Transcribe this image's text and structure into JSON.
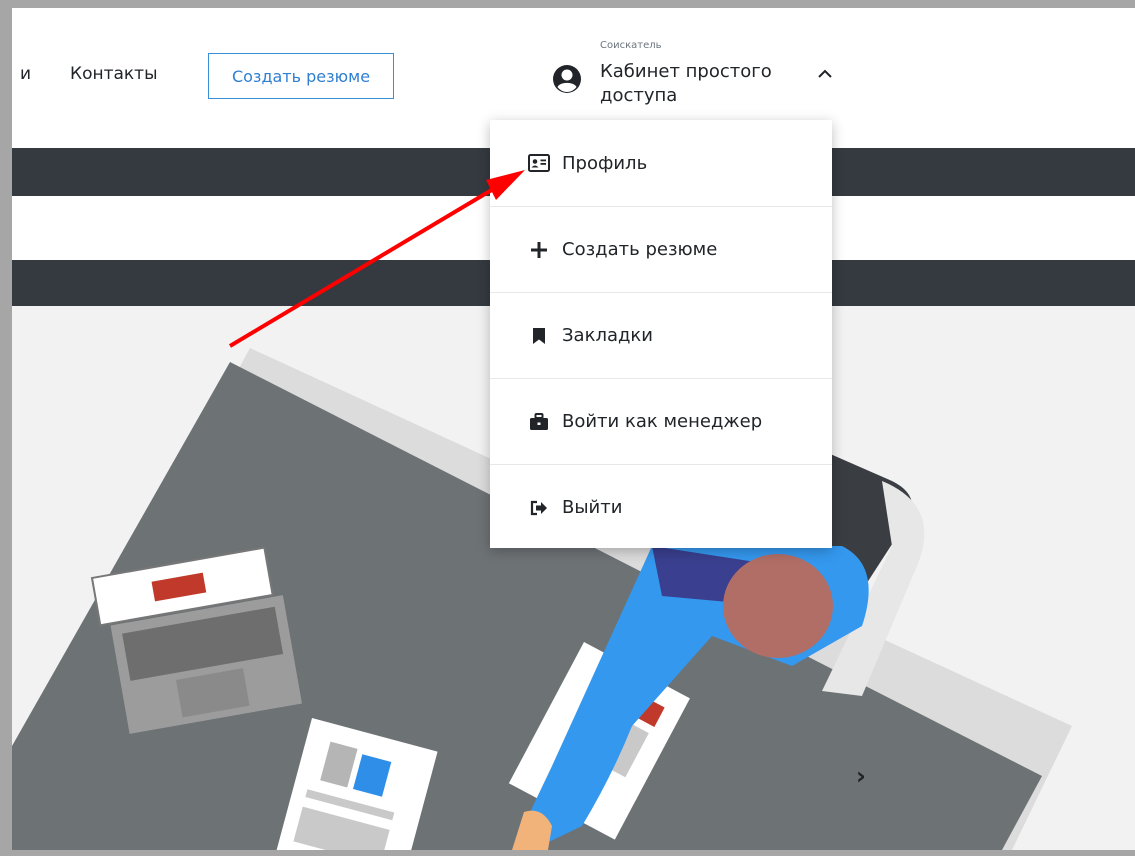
{
  "nav": {
    "truncated_item": "и",
    "contacts": "Контакты",
    "create_resume_button": "Создать резюме"
  },
  "cabinet": {
    "role": "Соискатель",
    "name": "Кабинет простого доступа",
    "icon": "user-circle-icon",
    "expanded_icon": "chevron-up-icon"
  },
  "dropdown": {
    "items": [
      {
        "label": "Профиль",
        "icon": "id-card-icon"
      },
      {
        "label": "Создать резюме",
        "icon": "plus-icon"
      },
      {
        "label": "Закладки",
        "icon": "bookmark-icon"
      },
      {
        "label": "Войти как менеджер",
        "icon": "briefcase-icon"
      },
      {
        "label": "Выйти",
        "icon": "sign-out-icon"
      }
    ]
  },
  "carousel": {
    "next": "›"
  },
  "colors": {
    "accent": "#2f7fd1",
    "dark_band": "#343a40",
    "annotation_arrow": "#ff0000"
  }
}
